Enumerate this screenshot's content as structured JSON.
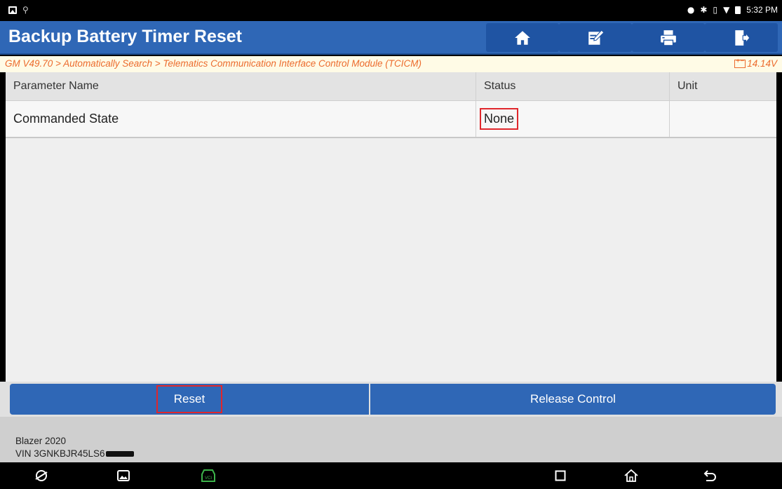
{
  "status_bar": {
    "time": "5:32 PM"
  },
  "header": {
    "title": "Backup Battery Timer Reset",
    "buttons": [
      {
        "name": "home",
        "icon": "home-icon"
      },
      {
        "name": "edit",
        "icon": "edit-icon"
      },
      {
        "name": "print",
        "icon": "print-icon"
      },
      {
        "name": "exit",
        "icon": "exit-icon"
      }
    ]
  },
  "breadcrumb": {
    "path": "GM V49.70 > Automatically Search > Telematics Communication Interface Control Module (TCICM)",
    "voltage": "14.14V"
  },
  "table": {
    "headers": [
      "Parameter Name",
      "Status",
      "Unit"
    ],
    "rows": [
      {
        "name": "Commanded State",
        "status": "None",
        "unit": ""
      }
    ]
  },
  "actions": {
    "reset_label": "Reset",
    "release_label": "Release Control"
  },
  "vehicle": {
    "model": "Blazer 2020",
    "vin": "VIN 3GNKBJR45LS6"
  },
  "colors": {
    "title_bar": "#2f67b6",
    "breadcrumb_text": "#ec6b2d",
    "highlight_box": "#e0262b",
    "vci_icon": "#3cb34a"
  }
}
